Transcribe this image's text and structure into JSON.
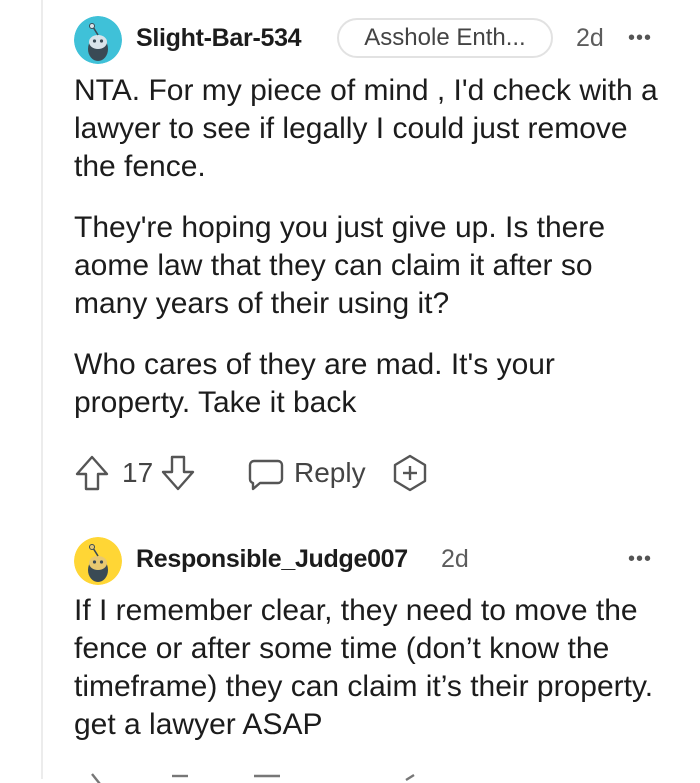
{
  "comments": [
    {
      "username": "Slight-Bar-534",
      "flair": "Asshole Enth...",
      "time": "2d",
      "more": "•••",
      "avatar_icon": "snoo-avatar-teal",
      "paragraphs": [
        "NTA. For my piece of mind , I'd check with a lawyer to see if legally I could just remove the fence.",
        "They're hoping you just give up. Is there aome law that they can claim it after so many years of their using it?",
        "Who cares of they are mad. It's your property. Take it back"
      ],
      "votes": "17",
      "reply_label": "Reply"
    },
    {
      "username": "Responsible_Judge007",
      "time": "2d",
      "more": "•••",
      "avatar_icon": "snoo-avatar-yellow",
      "paragraphs": [
        "If I remember clear, they need to move the fence or after some time (don’t know the timeframe) they can claim it’s their property. get a lawyer ASAP"
      ]
    }
  ],
  "colors": {
    "avatar_teal": "#3fc1d8",
    "avatar_yellow": "#ffd635",
    "text": "#1c1c1c",
    "meta": "#5c5c5c"
  }
}
